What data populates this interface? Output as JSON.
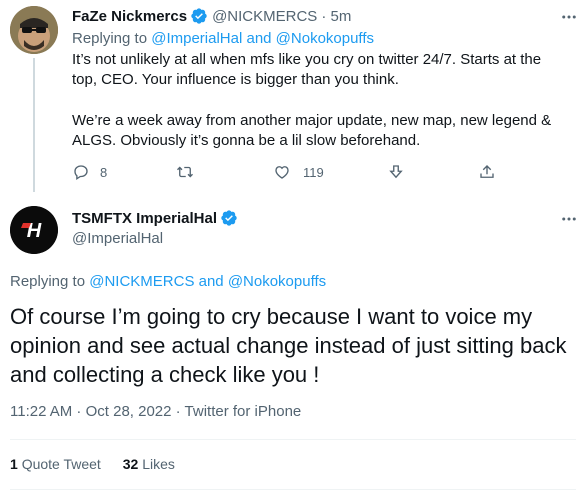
{
  "tweet1": {
    "author_name": "FaZe Nickmercs",
    "author_handle": "@NICKMERCS",
    "time": "· 5m",
    "replying_prefix": "Replying to ",
    "replying_to": "@ImperialHal and @Nokokopuffs",
    "paragraph1": "It’s not unlikely at all when mfs like you cry on twitter 24/7. Starts at the top, CEO. Your influence is bigger than you think.",
    "paragraph2": "We’re a week away from another major update, new map, new legend & ALGS. Obviously it’s gonna be a lil slow beforehand.",
    "reply_count": "8",
    "retweet_count": "",
    "like_count": "119"
  },
  "tweet2": {
    "author_name": "TSMFTX ImperialHal",
    "author_handle": "@ImperialHal",
    "replying_prefix": "Replying to ",
    "replying_to": "@NICKMERCS and @Nokokopuffs",
    "text": "Of course I’m going to cry because I want to voice my opinion and see actual change instead of just sitting back and collecting a check like you !",
    "timestamp": "11:22 AM · Oct 28, 2022 · Twitter for iPhone",
    "quote_count": "1",
    "quote_label": "Quote Tweet",
    "likes_count": "32",
    "likes_label": "Likes"
  },
  "colors": {
    "link": "#1d9bf0",
    "muted": "#536471",
    "text": "#0f1419",
    "divider": "#eff3f4"
  },
  "icons": [
    "verified-badge-icon",
    "more-options-icon",
    "reply-icon",
    "retweet-icon",
    "like-icon",
    "react-icon",
    "share-icon"
  ]
}
